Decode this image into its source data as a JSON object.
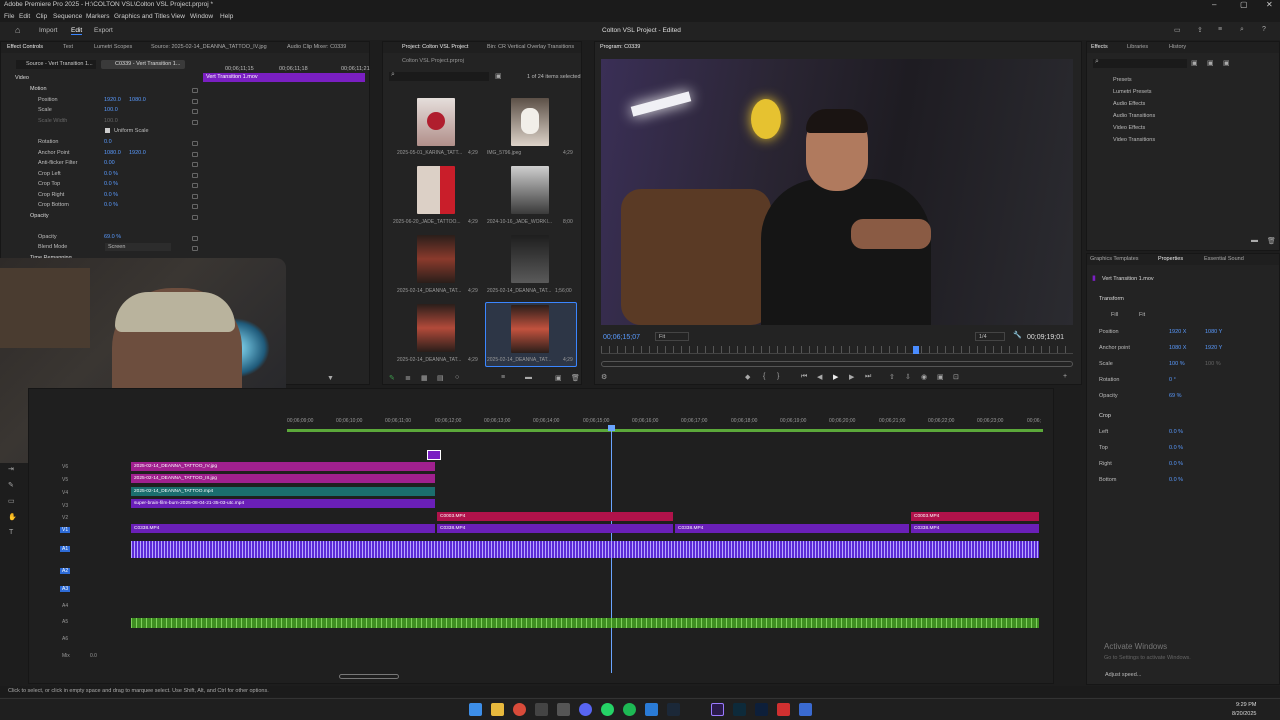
{
  "window": {
    "title": "Adobe Premiere Pro 2025 - H:\\COLTON VSL\\Colton VSL Project.prproj *"
  },
  "menu": [
    "File",
    "Edit",
    "Clip",
    "Sequence",
    "Markers",
    "Graphics and Titles",
    "View",
    "Window",
    "Help"
  ],
  "appbar": {
    "workspaces": [
      "Import",
      "Edit",
      "Export"
    ],
    "project_title": "Colton VSL Project - Edited"
  },
  "effect_controls": {
    "tabs": [
      "Effect Controls",
      "Text",
      "Lumetri Scopes",
      "Source: 2025-02-14_DEANNA_TATTOO_IV.jpg",
      "Audio Clip Mixer: C0339"
    ],
    "source_label": "Source - Vert Transition 1...",
    "seq_label": "C0339 - Vert Transition 1...",
    "timecodes": [
      "00;06;11;15",
      "00;06;11;18",
      "00;06;11;21"
    ],
    "clip_bar": "Vert Transition 1.mov",
    "video_header": "Video",
    "rows": [
      {
        "name": "Motion",
        "v1": "",
        "v2": ""
      },
      {
        "name": "Position",
        "v1": "1920.0",
        "v2": "1080.0"
      },
      {
        "name": "Scale",
        "v1": "100.0",
        "v2": ""
      },
      {
        "name": "Scale Width",
        "v1": "100.0",
        "v2": ""
      },
      {
        "name": "Uniform Scale",
        "v1": "",
        "v2": ""
      },
      {
        "name": "Rotation",
        "v1": "0.0",
        "v2": ""
      },
      {
        "name": "Anchor Point",
        "v1": "1080.0",
        "v2": "1920.0"
      },
      {
        "name": "Anti-flicker Filter",
        "v1": "0.00",
        "v2": ""
      },
      {
        "name": "Crop Left",
        "v1": "0.0 %",
        "v2": ""
      },
      {
        "name": "Crop Top",
        "v1": "0.0 %",
        "v2": ""
      },
      {
        "name": "Crop Right",
        "v1": "0.0 %",
        "v2": ""
      },
      {
        "name": "Crop Bottom",
        "v1": "0.0 %",
        "v2": ""
      },
      {
        "name": "Opacity",
        "v1": "",
        "v2": ""
      },
      {
        "name": "Opacity",
        "v1": "69.0 %",
        "v2": ""
      },
      {
        "name": "Blend Mode",
        "v1": "Screen",
        "v2": ""
      },
      {
        "name": "Time Remapping",
        "v1": "",
        "v2": ""
      }
    ]
  },
  "project": {
    "tabs": [
      "Project: Colton VSL Project",
      "Bin: CR Vertical Overlay Transitions"
    ],
    "path": "Colton VSL Project.prproj",
    "status": "1 of 24 items selected",
    "items": [
      {
        "name": "2025-05-01_KARINA_TATT...",
        "dur": "4;29"
      },
      {
        "name": "IMG_5796.jpeg",
        "dur": "4;29"
      },
      {
        "name": "2025-06-20_JADE_TATTOO...",
        "dur": "4;29"
      },
      {
        "name": "2024-10-16_JADE_WORKI...",
        "dur": "8;00"
      },
      {
        "name": "2025-02-14_DEANNA_TAT...",
        "dur": "4;29"
      },
      {
        "name": "2025-02-14_DEANNA_TAT...",
        "dur": "1;56;00"
      },
      {
        "name": "2025-02-14_DEANNA_TAT...",
        "dur": "4;29"
      },
      {
        "name": "2025-02-14_DEANNA_TAT...",
        "dur": "4;29"
      }
    ]
  },
  "program": {
    "tab": "Program: C0339",
    "timecode": "00;06;15;07",
    "fit": "Fit",
    "quality": "1/4",
    "duration": "00;09;19;01",
    "playhead_fraction": 0.66
  },
  "effects": {
    "tabs": [
      "Effects",
      "Libraries",
      "History"
    ],
    "tree": [
      "Presets",
      "Lumetri Presets",
      "Audio Effects",
      "Audio Transitions",
      "Video Effects",
      "Video Transitions"
    ]
  },
  "properties": {
    "tabs": [
      "Graphics Templates",
      "Properties",
      "Essential Sound"
    ],
    "clip": "Vert Transition 1.mov",
    "transform_header": "Transform",
    "fill": "Fill",
    "fit": "Fit",
    "rows": [
      {
        "name": "Position",
        "v1": "1920 X",
        "v2": "1080 Y"
      },
      {
        "name": "Anchor point",
        "v1": "1080 X",
        "v2": "1920 Y"
      },
      {
        "name": "Scale",
        "v1": "100 %",
        "v2": "100 %"
      },
      {
        "name": "Rotation",
        "v1": "0 °",
        "v2": ""
      },
      {
        "name": "Opacity",
        "v1": "69 %",
        "v2": ""
      }
    ],
    "crop_header": "Crop",
    "crop": [
      {
        "name": "Left",
        "v": "0.0 %"
      },
      {
        "name": "Top",
        "v": "0.0 %"
      },
      {
        "name": "Right",
        "v": "0.0 %"
      },
      {
        "name": "Bottom",
        "v": "0.0 %"
      }
    ],
    "activate": "Activate Windows",
    "activate_sub": "Go to Settings to activate Windows.",
    "adjust": "Adjust speed..."
  },
  "timeline": {
    "ruler": [
      "00;06;09;00",
      "00;06;10;00",
      "00;06;11;00",
      "00;06;12;00",
      "00;06;13;00",
      "00;06;14;00",
      "00;06;15;00",
      "00;06;16;00",
      "00;06;17;00",
      "00;06;18;00",
      "00;06;19;00",
      "00;06;20;00",
      "00;06;21;00",
      "00;06;22;00",
      "00;06;23;00",
      "00;06;"
    ],
    "tracks": [
      "V6",
      "V5",
      "V4",
      "V3",
      "V2",
      "V1",
      "A1",
      "A2",
      "A3",
      "A4",
      "A5",
      "A6",
      "Mix"
    ],
    "mix_value": "0.0",
    "clips": {
      "v6": "2025-02-14_DEANNA_TATTOO_IV.jpg",
      "v5": "2025-02-14_DEANNA_TATTOO_III.jpg",
      "v4": "2025-02-14_DEANNA_TATTOO.mp4",
      "v3": "super-brain-film-burn-2025-08-04-21-35-03-utc.mp4",
      "v2a": "C0003.MP4",
      "v2b": "C0003.MP4",
      "v1a": "C0338.MP4",
      "v1b": "C0338.MP4",
      "v1c": "C0338.MP4",
      "v1d": "C0338.MP4"
    }
  },
  "status_bar": "Click to select, or click in empty space and drag to marquee select. Use Shift, Alt, and Ctrl for other options.",
  "taskbar": {
    "time": "9:29 PM",
    "date": "8/20/2025"
  },
  "colors": {
    "accent": "#3b86ff",
    "purple": "#7a1fc2",
    "magenta": "#a0208e",
    "teal": "#1b6e6e",
    "crimson": "#b0124a",
    "audio": "#5b2bd6",
    "green": "#3f8f22"
  }
}
